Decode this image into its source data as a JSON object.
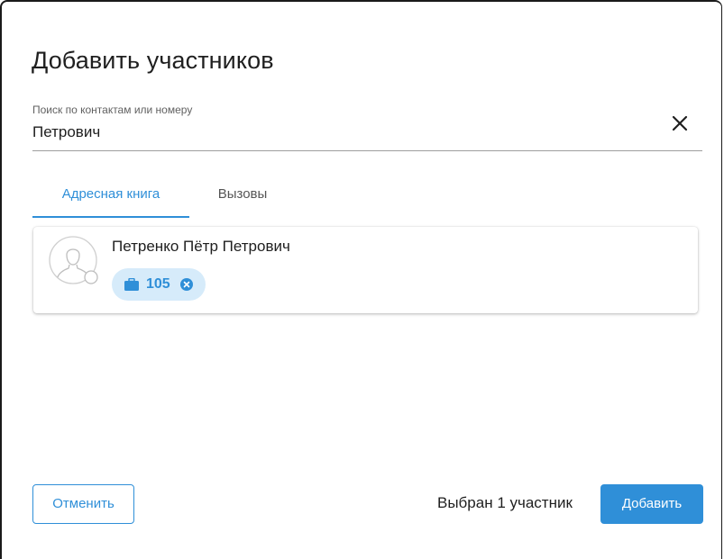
{
  "dialog": {
    "title": "Добавить участников"
  },
  "search": {
    "label": "Поиск по контактам или номеру",
    "value": "Петрович",
    "clear_icon": "close-icon"
  },
  "tabs": [
    {
      "label": "Адресная книга",
      "active": true
    },
    {
      "label": "Вызовы",
      "active": false
    }
  ],
  "contacts": [
    {
      "name": "Петренко Пётр Петрович",
      "avatar_icon": "user-avatar-icon",
      "status_icon": "presence-offline-icon",
      "extension": {
        "icon": "briefcase-icon",
        "number": "105",
        "remove_icon": "remove-circle-icon"
      }
    }
  ],
  "footer": {
    "cancel_label": "Отменить",
    "selected_text": "Выбран 1 участник",
    "add_label": "Добавить"
  },
  "colors": {
    "accent": "#2f8fd8",
    "chip_background": "#d6ebfa",
    "text": "#1f1f1f"
  }
}
